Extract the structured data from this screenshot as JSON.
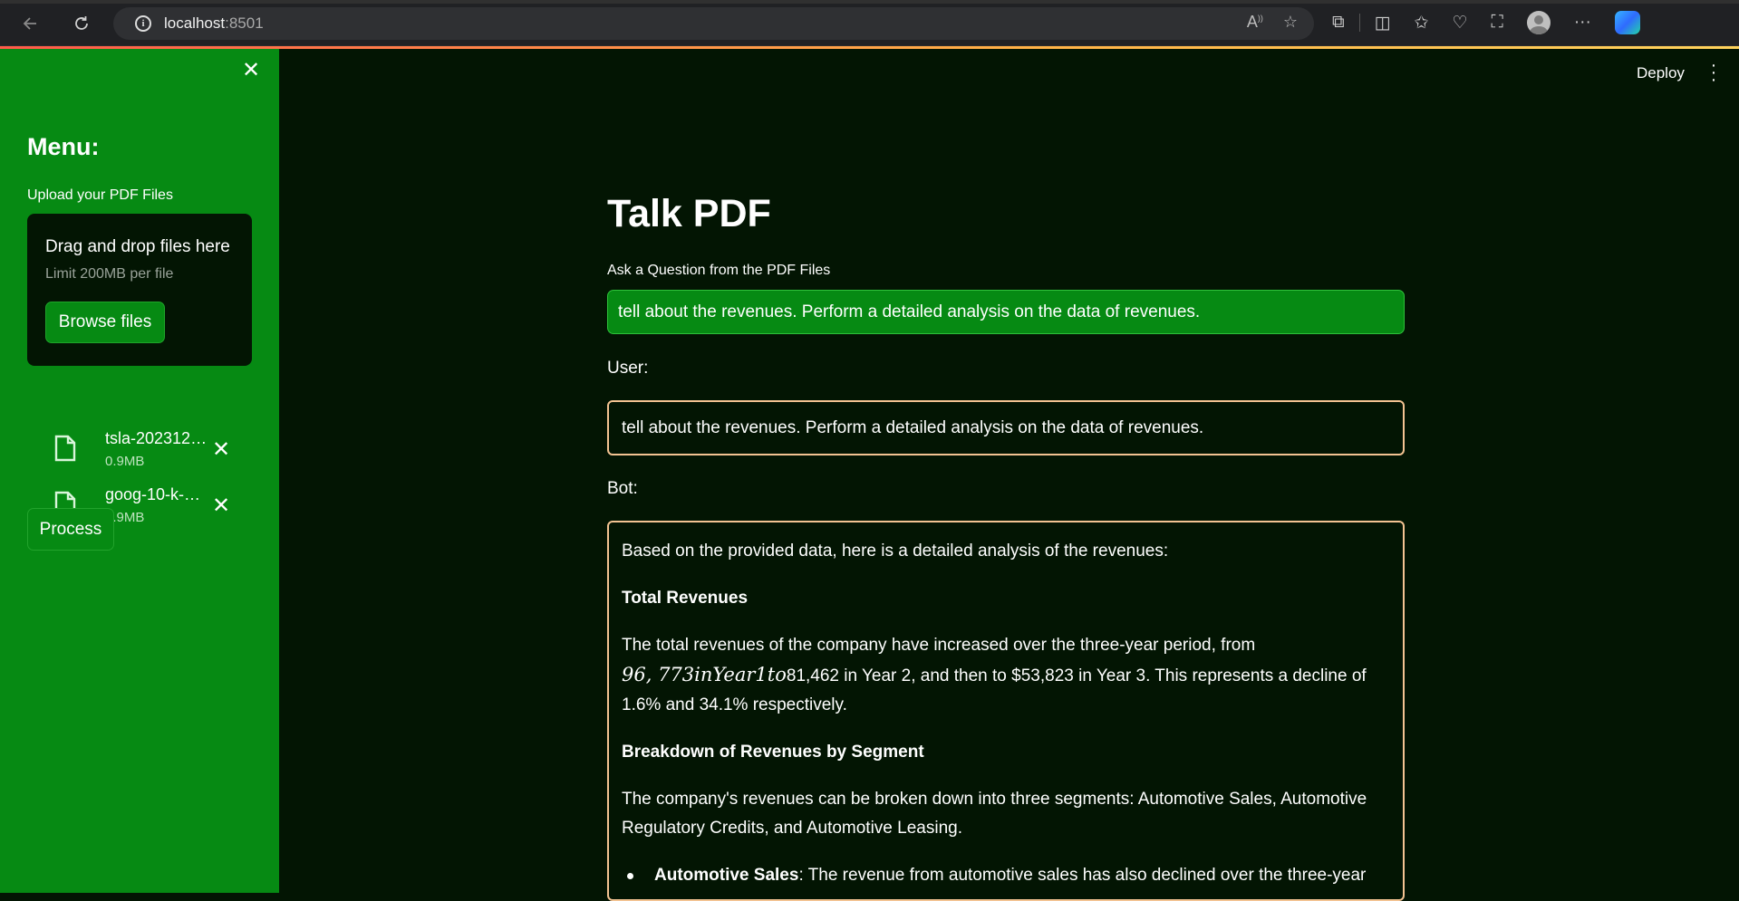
{
  "browser": {
    "url_host": "localhost",
    "url_port": ":8501"
  },
  "sidebar": {
    "menu_title": "Menu:",
    "upload_label": "Upload your PDF Files",
    "dropzone_title": "Drag and drop files here",
    "dropzone_limit": "Limit 200MB per file",
    "browse_label": "Browse files",
    "files": [
      {
        "name": "tsla-202312…",
        "size": "0.9MB"
      },
      {
        "name": "goog-10-k-…",
        "size": "0.9MB"
      }
    ],
    "process_label": "Process"
  },
  "header": {
    "deploy_label": "Deploy"
  },
  "main": {
    "title": "Talk PDF",
    "ask_label": "Ask a Question from the PDF Files",
    "ask_value": "tell about the revenues. Perform a detailed analysis on the data of revenues.",
    "user_label": "User:",
    "user_message": "tell about the revenues. Perform a detailed analysis on the data of revenues.",
    "bot_label": "Bot:",
    "bot": {
      "intro": "Based on the provided data, here is a detailed analysis of the revenues:",
      "h1": "Total Revenues",
      "p1_a": "The total revenues of the company have increased over the three-year period, from",
      "p1_math": "96, 773inYear1to",
      "p1_b": "81,462 in Year 2, and then to $53,823 in Year 3. This represents a decline of 1.6% and 34.1% respectively.",
      "h2": "Breakdown of Revenues by Segment",
      "p2": "The company's revenues can be broken down into three segments: Automotive Sales, Automotive Regulatory Credits, and Automotive Leasing.",
      "li1_bold": "Automotive Sales",
      "li1_text": ": The revenue from automotive sales has also declined over the three-year"
    }
  }
}
